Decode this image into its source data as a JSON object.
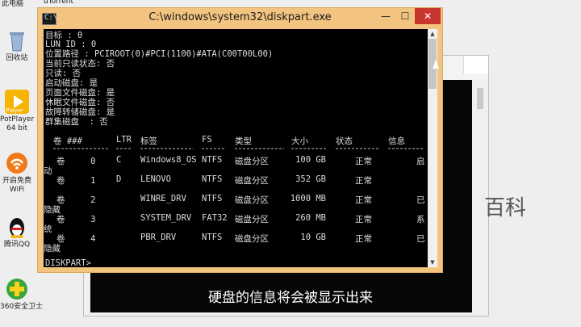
{
  "desktop": {
    "icons": [
      {
        "name": "computer",
        "label": "此电脑",
        "color": "#5a8fd4"
      },
      {
        "name": "recycle-bin",
        "label": "回收站",
        "color": "#8fa9c9"
      },
      {
        "name": "potplayer",
        "label": "PotPlayer 64 bit",
        "tile_text": "Player",
        "color": "#f5b400"
      },
      {
        "name": "wifi",
        "label": "开启免费 WiFi",
        "color": "#f07a1a"
      },
      {
        "name": "qq",
        "label": "腾讯QQ",
        "color": "#111111"
      },
      {
        "name": "security",
        "label": "360安全卫士",
        "color": "#3aa53a"
      }
    ],
    "top_fragment": "uTorrent"
  },
  "window": {
    "title": "C:\\windows\\system32\\diskpart.exe",
    "min_glyph": "—",
    "max_glyph": "☐",
    "close_glyph": "✕"
  },
  "console": {
    "info_lines": [
      "目标 : 0",
      "LUN ID : 0",
      "位置路径 : PCIROOT(0)#PCI(1100)#ATA(C00T00L00)",
      "当前只读状态: 否",
      "只读: 否",
      "启动磁盘: 是",
      "页面文件磁盘: 是",
      "休眠文件磁盘: 否",
      "故障转储磁盘: 是",
      "群集磁盘  : 否"
    ],
    "headers": [
      "卷 ###",
      "LTR",
      "标签",
      "FS",
      "类型",
      "大小",
      "状态",
      "信息"
    ],
    "volumes": [
      {
        "vol": "卷     0",
        "ltr": "C",
        "label": "Windows8_OS",
        "fs": "NTFS",
        "type": "磁盘分区",
        "size": "100 GB",
        "status": "正常",
        "info": "启",
        "wrap": "动"
      },
      {
        "vol": "卷     1",
        "ltr": "D",
        "label": "LENOVO",
        "fs": "NTFS",
        "type": "磁盘分区",
        "size": "352 GB",
        "status": "正常",
        "info": "",
        "wrap": ""
      },
      {
        "vol": "卷     2",
        "ltr": "",
        "label": "WINRE_DRV",
        "fs": "NTFS",
        "type": "磁盘分区",
        "size": "1000 MB",
        "status": "正常",
        "info": "已",
        "wrap": "隐藏"
      },
      {
        "vol": "卷     3",
        "ltr": "",
        "label": "SYSTEM_DRV",
        "fs": "FAT32",
        "type": "磁盘分区",
        "size": "260 MB",
        "status": "正常",
        "info": "系",
        "wrap": "统"
      },
      {
        "vol": "卷     4",
        "ltr": "",
        "label": "PBR_DRV",
        "fs": "NTFS",
        "type": "磁盘分区",
        "size": "10 GB",
        "status": "正常",
        "info": "已",
        "wrap": "隐藏"
      }
    ],
    "prompt": "DISKPART>"
  },
  "background": {
    "brand_fragment": "百科"
  },
  "caption": "硬盘的信息将会被显示出来"
}
